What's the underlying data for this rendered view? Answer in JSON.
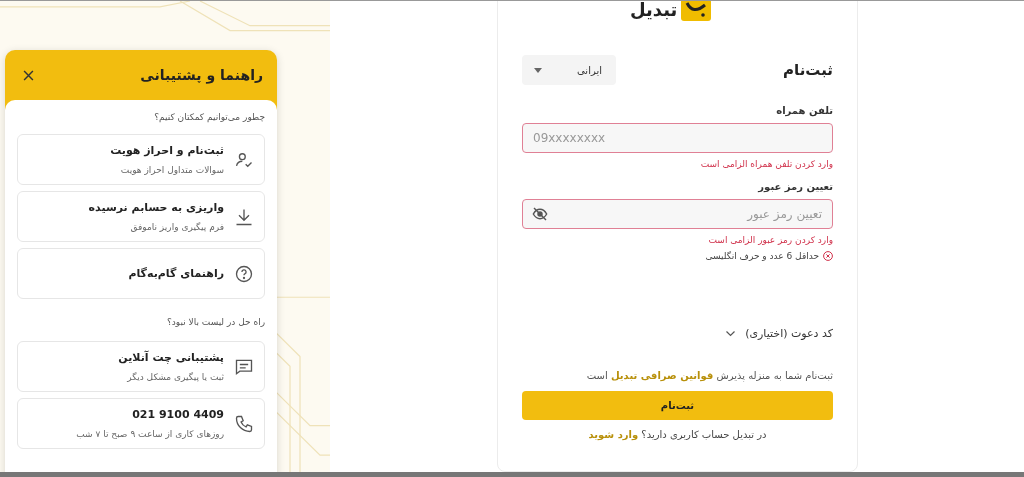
{
  "logo": {
    "name": "تبدیل"
  },
  "help_panel": {
    "title": "راهنما و پشتیبانی",
    "prompt": "چطور می‌توانیم کمکتان کنیم؟",
    "topics": [
      {
        "kind": "identity",
        "title": "ثبت‌نام و احراز هویت",
        "subtitle": "سوالات متداول احراز هویت"
      },
      {
        "kind": "download",
        "title": "واریزی به حسابم نرسیده",
        "subtitle": "فرم پیگیری واریز ناموفق"
      },
      {
        "kind": "help",
        "title": "راهنمای گام‌به‌گام"
      }
    ],
    "fallback_prompt": "راه حل در لیست بالا نبود؟",
    "contacts": [
      {
        "kind": "chat",
        "title": "پشتیبانی چت آنلاین",
        "subtitle": "ثبت یا پیگیری مشکل دیگر"
      },
      {
        "kind": "phone",
        "title": "021 9100 4409",
        "subtitle": "روزهای کاری از ساعت ۹ صبح تا ۷ شب"
      }
    ]
  },
  "signup": {
    "title": "ثبت‌نام",
    "nationality": "ایرانی",
    "fields": [
      {
        "kind": "phone",
        "label": "تلفن همراه",
        "placeholder": "09xxxxxxxx",
        "invalid": true,
        "error": "وارد کردن تلفن همراه الزامی است"
      },
      {
        "kind": "password",
        "label": "تعیین رمز عبور",
        "placeholder": "تعیین رمز عبور",
        "invalid": true,
        "error": "وارد کردن رمز عبور الزامی است",
        "hint": "حداقل 6 عدد و حرف انگلیسی",
        "hint_met": false
      }
    ],
    "invite": {
      "label": "کد دعوت (اختیاری)",
      "expanded": false
    },
    "terms": {
      "before": "ثبت‌نام شما به منزله پذیرش",
      "link": "قوانین صرافی تبدیل",
      "after": "است"
    },
    "submit": "ثبت‌نام",
    "login": {
      "question": "در تبدیل حساب کاربری دارید؟",
      "link": "وارد شوید"
    }
  }
}
